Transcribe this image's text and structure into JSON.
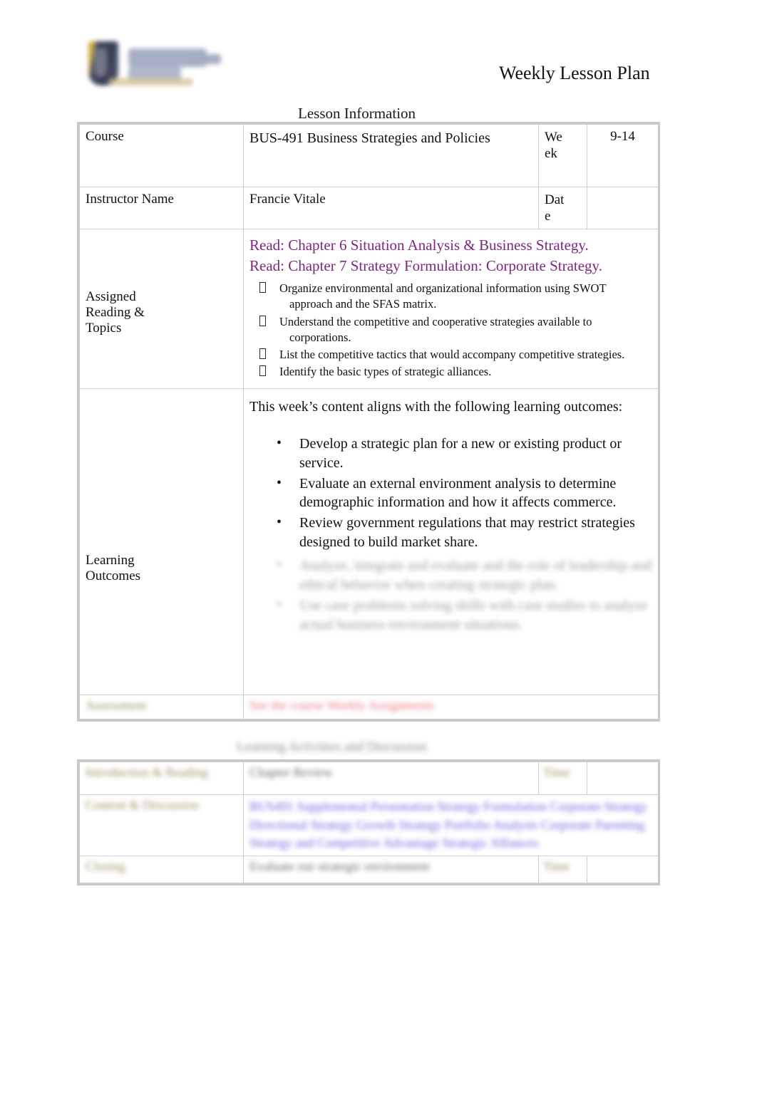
{
  "document": {
    "title": "Weekly Lesson Plan",
    "logo_alt": "university-logo"
  },
  "sections": {
    "lesson_information_caption": "Lesson Information",
    "learning_activities_caption": "Learning Activities and Discussion"
  },
  "lesson_information": {
    "course_label": "Course",
    "course_value": "BUS-491 Business Strategies and Policies",
    "week_label": "Week",
    "week_value": "9-14",
    "instructor_label": "Instructor Name",
    "instructor_value": "Francie Vitale",
    "date_label": "Date",
    "date_value": ""
  },
  "assigned_reading": {
    "label": "Assigned Reading & Topics",
    "readings": [
      "Read: Chapter 6 Situation Analysis & Business Strategy.",
      "Read:  Chapter 7 Strategy Formulation:    Corporate Strategy."
    ],
    "topics": [
      {
        "line1": "Organize environmental and organizational information using SWOT",
        "line2": "approach and the SFAS matrix."
      },
      {
        "line1": "Understand the competitive and cooperative strategies available to",
        "line2": "corporations."
      },
      {
        "line1": "List the competitive tactics that would accompany competitive strategies.",
        "line2": ""
      },
      {
        "line1": "Identify the basic types of strategic alliances.",
        "line2": ""
      }
    ]
  },
  "learning_outcomes": {
    "label": "Learning Outcomes",
    "intro": "This week’s content aligns with the following learning outcomes:",
    "items": [
      "Develop a strategic plan for a new or existing product or service.",
      "Evaluate an external environment analysis to determine demographic information and how it affects commerce.",
      "Review government regulations that may restrict strategies designed to build market share."
    ],
    "obscured_items": [
      "Analyze, integrate and evaluate and the role of leadership and ethical behavior when creating strategic plan.",
      "Use case problems solving skills with case studies to analyze actual business environment situations."
    ]
  },
  "assessment_row": {
    "label": "Assessment",
    "value": "See the course Weekly Assignments"
  },
  "learning_activities": {
    "intro_label": "Introduction & Reading",
    "intro_value": "Chapter Review",
    "intro_time_label": "Time",
    "intro_time_value": "",
    "content_label": "Content & Discussion",
    "content_value": "BUS491 Supplemental Presentation Strategy Formulation Corporate Strategy Directional Strategy Growth Strategy Portfolio Analysis Corporate Parenting Strategy and Competitive Advantage Strategic Alliances",
    "closing_label": "Closing",
    "closing_value": "Evaluate our strategic environment",
    "closing_time_label": "Time",
    "closing_time_value": ""
  },
  "colors": {
    "label_cell_fill": "#FBE9B7",
    "reading_text": "#7D267D",
    "alert_text": "#E8596A",
    "link_text": "#4C43D8",
    "table_border": "#CFCFCF",
    "frame_border": "#C8C8C8"
  },
  "icons": {
    "bullet_box": "missing-glyph-box-icon",
    "bullet_dot": "bullet-dot-icon"
  }
}
